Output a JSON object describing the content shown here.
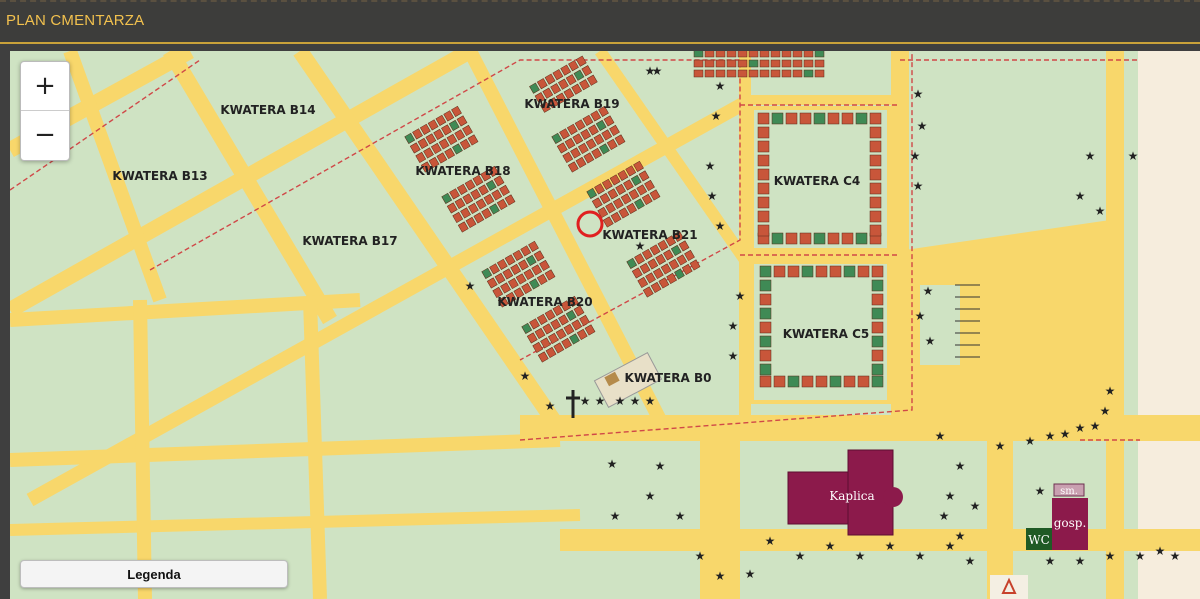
{
  "header": {
    "title": "PLAN CMENTARZA"
  },
  "zoom": {
    "in_label": "+",
    "out_label": "−"
  },
  "legend": {
    "label": "Legenda"
  },
  "map": {
    "sections": {
      "b14": "KWATERA B14",
      "b13": "KWATERA B13",
      "b17": "KWATERA B17",
      "b18": "KWATERA B18",
      "b19": "KWATERA B19",
      "b20": "KWATERA B20",
      "b21": "KWATERA B21",
      "b0": "KWATERA B0",
      "c4": "KWATERA C4",
      "c5": "KWATERA C5"
    },
    "buildings": {
      "chapel": "Kaplica",
      "wc": "WC",
      "gosp": "gosp.",
      "sm": "sm."
    },
    "colors": {
      "road": "#f8d76b",
      "grass": "#cfe3c3",
      "grave": "#c8563a",
      "grave_green": "#3f8a55",
      "chapel": "#8c1a4b",
      "boundary": "#d04848"
    },
    "marker": "selected-grave-marker"
  }
}
